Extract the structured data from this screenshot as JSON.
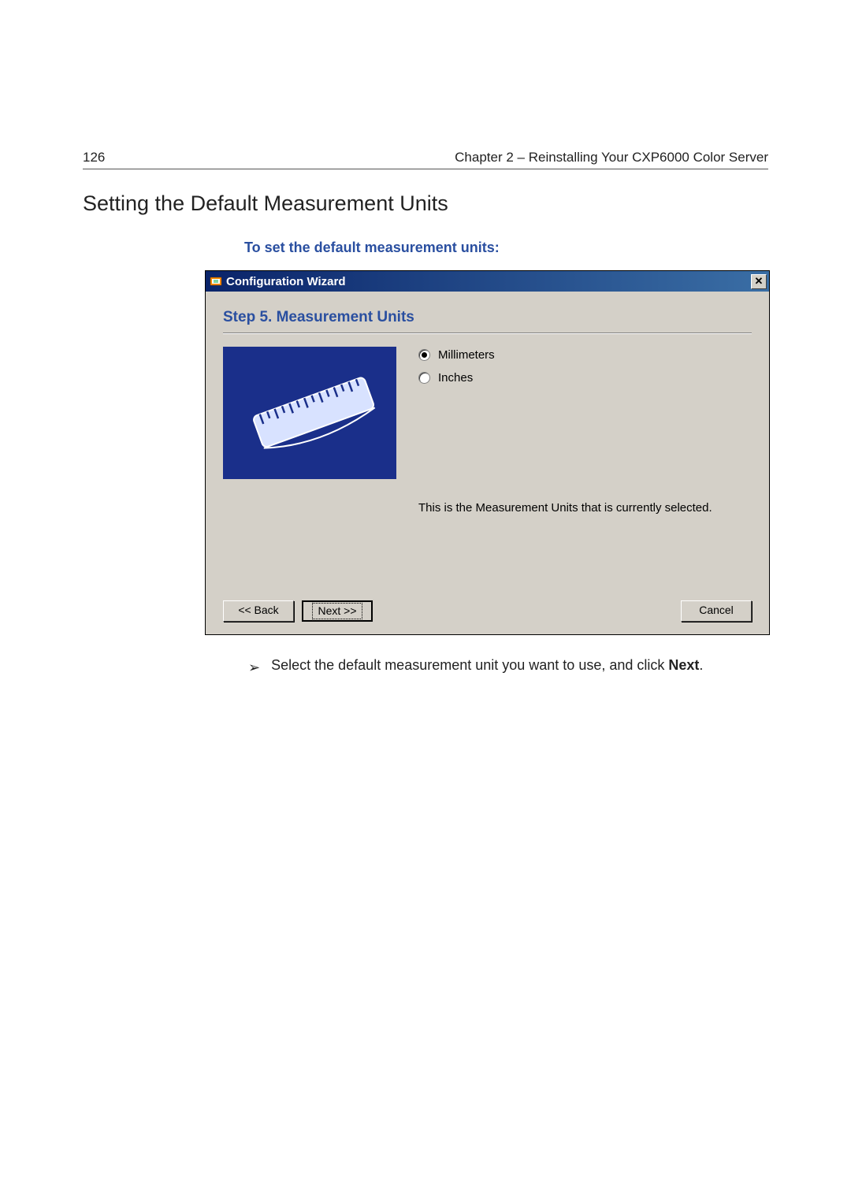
{
  "header": {
    "page_number": "126",
    "chapter": "Chapter 2 – Reinstalling Your CXP6000 Color Server"
  },
  "section_heading": "Setting the Default Measurement Units",
  "sub_instruction": "To set the default measurement units:",
  "dialog": {
    "title": "Configuration Wizard",
    "close_glyph": "✕",
    "step_title": "Step 5. Measurement Units",
    "options": {
      "millimeters": "Millimeters",
      "inches": "Inches",
      "selected": "millimeters"
    },
    "description": "This is the Measurement Units that is currently selected.",
    "buttons": {
      "back": "<< Back",
      "next": "Next >>",
      "cancel": "Cancel"
    }
  },
  "instruction": {
    "bullet": "➢",
    "text_before": "Select the default measurement unit you want to use, and click ",
    "bold": "Next",
    "text_after": "."
  }
}
